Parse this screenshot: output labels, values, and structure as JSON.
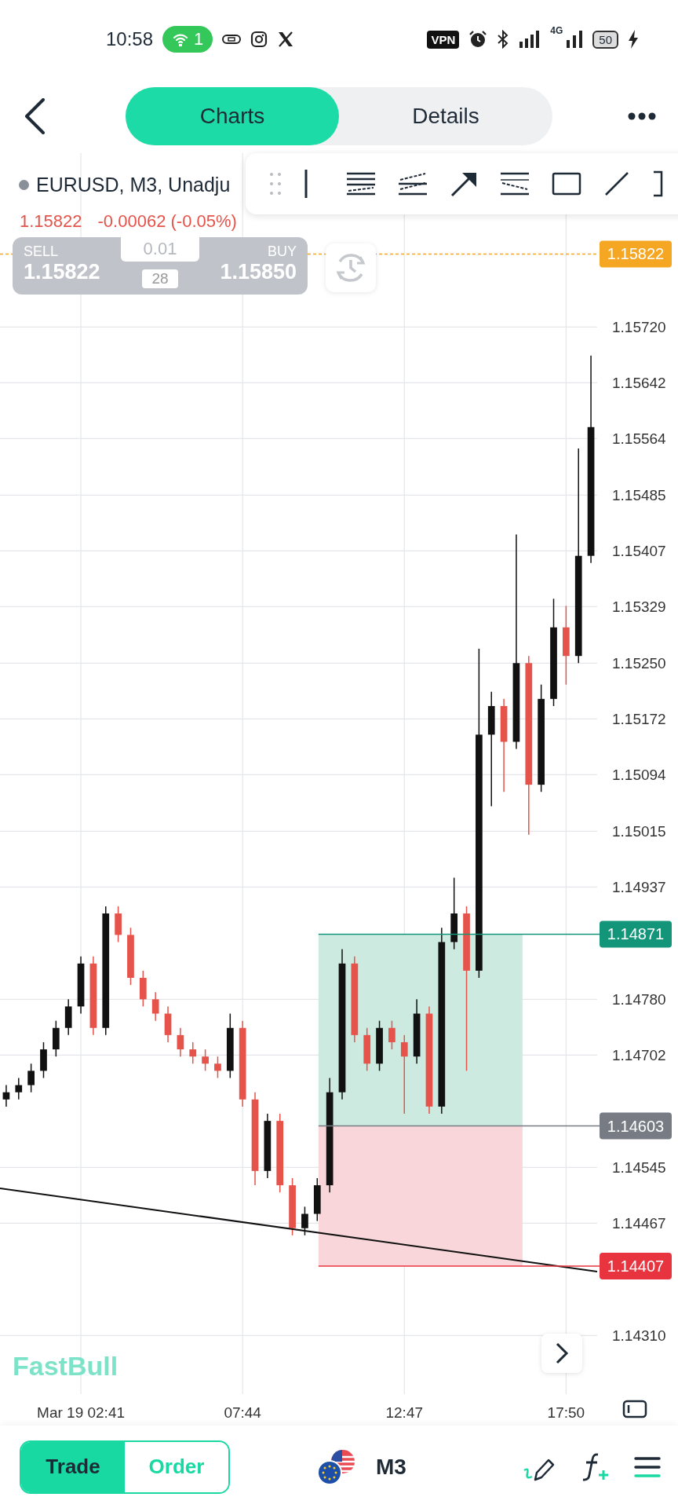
{
  "status_bar": {
    "time": "10:58",
    "hotspot_count": "1",
    "vpn": "VPN",
    "network": "4G",
    "battery": "50"
  },
  "nav": {
    "tabs": [
      {
        "label": "Charts",
        "selected": true
      },
      {
        "label": "Details",
        "selected": false
      }
    ]
  },
  "symbol": {
    "title": "EURUSD, M3, Unadju",
    "price": "1.15822",
    "change": "-0.00062 (-0.05%)"
  },
  "trade_panel": {
    "sell_label": "SELL",
    "sell_price": "1.15822",
    "lot": "0.01",
    "spread": "28",
    "buy_label": "BUY",
    "buy_price": "1.15850"
  },
  "logo": "FastBull",
  "chart": {
    "chart_data": {
      "type": "candlestick",
      "categories": [
        null,
        null,
        null,
        null,
        null,
        null,
        "Mar 19 02:41",
        null,
        null,
        null,
        null,
        null,
        null,
        null,
        null,
        null,
        null,
        null,
        null,
        "07:44",
        null,
        null,
        null,
        null,
        null,
        null,
        null,
        null,
        null,
        null,
        null,
        null,
        "12:47",
        null,
        null,
        null,
        null,
        null,
        null,
        null,
        null,
        null,
        null,
        null,
        null,
        "17:50",
        null,
        null
      ],
      "ohlc": [
        [
          1.1464,
          1.1466,
          1.1463,
          1.1465
        ],
        [
          1.1465,
          1.1467,
          1.1464,
          1.1466
        ],
        [
          1.1466,
          1.1469,
          1.1465,
          1.1468
        ],
        [
          1.1468,
          1.1472,
          1.1467,
          1.1471
        ],
        [
          1.1471,
          1.1475,
          1.147,
          1.1474
        ],
        [
          1.1474,
          1.1478,
          1.1473,
          1.1477
        ],
        [
          1.1477,
          1.1484,
          1.1476,
          1.1483
        ],
        [
          1.1483,
          1.1484,
          1.1473,
          1.1474
        ],
        [
          1.1474,
          1.1491,
          1.1473,
          1.149
        ],
        [
          1.149,
          1.1491,
          1.1486,
          1.1487
        ],
        [
          1.1487,
          1.1488,
          1.148,
          1.1481
        ],
        [
          1.1481,
          1.1482,
          1.1477,
          1.1478
        ],
        [
          1.1478,
          1.1479,
          1.1475,
          1.1476
        ],
        [
          1.1476,
          1.1477,
          1.1472,
          1.1473
        ],
        [
          1.1473,
          1.1474,
          1.147,
          1.1471
        ],
        [
          1.1471,
          1.1472,
          1.1469,
          1.147
        ],
        [
          1.147,
          1.1471,
          1.1468,
          1.1469
        ],
        [
          1.1469,
          1.147,
          1.1467,
          1.1468
        ],
        [
          1.1468,
          1.1476,
          1.1467,
          1.1474
        ],
        [
          1.1474,
          1.1475,
          1.1463,
          1.1464
        ],
        [
          1.1464,
          1.1465,
          1.1452,
          1.1454
        ],
        [
          1.1454,
          1.1462,
          1.1453,
          1.1461
        ],
        [
          1.1461,
          1.1462,
          1.1451,
          1.1452
        ],
        [
          1.1452,
          1.1453,
          1.1445,
          1.1446
        ],
        [
          1.1446,
          1.1449,
          1.1445,
          1.1448
        ],
        [
          1.1448,
          1.1453,
          1.1447,
          1.1452
        ],
        [
          1.1452,
          1.1467,
          1.1451,
          1.1465
        ],
        [
          1.1465,
          1.1485,
          1.1464,
          1.1483
        ],
        [
          1.1483,
          1.1484,
          1.1472,
          1.1473
        ],
        [
          1.1473,
          1.1474,
          1.1468,
          1.1469
        ],
        [
          1.1469,
          1.1475,
          1.1468,
          1.1474
        ],
        [
          1.1474,
          1.1475,
          1.1471,
          1.1472
        ],
        [
          1.1472,
          1.1473,
          1.1462,
          1.147
        ],
        [
          1.147,
          1.1478,
          1.1469,
          1.1476
        ],
        [
          1.1476,
          1.1477,
          1.1462,
          1.1463
        ],
        [
          1.1463,
          1.1488,
          1.1462,
          1.1486
        ],
        [
          1.1486,
          1.1495,
          1.1485,
          1.149
        ],
        [
          1.149,
          1.1491,
          1.1468,
          1.1482
        ],
        [
          1.1482,
          1.1527,
          1.1481,
          1.1515
        ],
        [
          1.1515,
          1.1521,
          1.1505,
          1.1519
        ],
        [
          1.1519,
          1.152,
          1.1507,
          1.1514
        ],
        [
          1.1514,
          1.1543,
          1.1513,
          1.1525
        ],
        [
          1.1525,
          1.1526,
          1.1501,
          1.1508
        ],
        [
          1.1508,
          1.1522,
          1.1507,
          1.152
        ],
        [
          1.152,
          1.1534,
          1.1519,
          1.153
        ],
        [
          1.153,
          1.1533,
          1.1522,
          1.1526
        ],
        [
          1.1526,
          1.1555,
          1.1525,
          1.154
        ],
        [
          1.154,
          1.1568,
          1.1539,
          1.1558
        ]
      ],
      "ylim": [
        1.14228,
        1.15963
      ],
      "yticks": [
        {
          "value": 1.1572,
          "label": "1.15720"
        },
        {
          "value": 1.15642,
          "label": "1.15642"
        },
        {
          "value": 1.15564,
          "label": "1.15564"
        },
        {
          "value": 1.15485,
          "label": "1.15485"
        },
        {
          "value": 1.15407,
          "label": "1.15407"
        },
        {
          "value": 1.15329,
          "label": "1.15329"
        },
        {
          "value": 1.1525,
          "label": "1.15250"
        },
        {
          "value": 1.15172,
          "label": "1.15172"
        },
        {
          "value": 1.15094,
          "label": "1.15094"
        },
        {
          "value": 1.15015,
          "label": "1.15015"
        },
        {
          "value": 1.14937,
          "label": "1.14937"
        },
        {
          "value": 1.1478,
          "label": "1.14780"
        },
        {
          "value": 1.14702,
          "label": "1.14702"
        },
        {
          "value": 1.14545,
          "label": "1.14545"
        },
        {
          "value": 1.14467,
          "label": "1.14467"
        },
        {
          "value": 1.1431,
          "label": "1.14310"
        }
      ],
      "grid": true,
      "ref_lines": [
        {
          "axis": "y",
          "value": 1.15822,
          "label": "1.15822",
          "color": "#f5a623"
        },
        {
          "axis": "y",
          "value": 1.14871,
          "label": "1.14871",
          "color": "#13957a"
        },
        {
          "axis": "y",
          "value": 1.14603,
          "label": "1.14603",
          "color": "#767b84"
        },
        {
          "axis": "y",
          "value": 1.14407,
          "label": "1.14407",
          "color": "#e8343f"
        }
      ],
      "bands": [
        {
          "axis": "y",
          "from": 1.14603,
          "to": 1.14871,
          "color": "#cdeae1"
        },
        {
          "axis": "y",
          "from": 1.14407,
          "to": 1.14603,
          "color": "#f9d6d9"
        }
      ]
    }
  },
  "bottom_bar": {
    "modes": [
      {
        "label": "Trade",
        "selected": true
      },
      {
        "label": "Order",
        "selected": false
      }
    ],
    "timeframe": "M3"
  }
}
